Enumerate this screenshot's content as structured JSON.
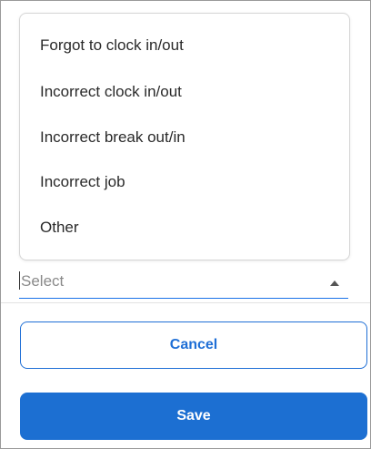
{
  "dropdown": {
    "options": [
      {
        "label": "Forgot to clock in/out"
      },
      {
        "label": "Incorrect clock in/out"
      },
      {
        "label": "Incorrect break out/in"
      },
      {
        "label": "Incorrect job"
      },
      {
        "label": "Other"
      }
    ],
    "arrow_icon": "caret-up-icon"
  },
  "select": {
    "placeholder": "Select"
  },
  "actions": {
    "cancel_label": "Cancel",
    "save_label": "Save"
  },
  "colors": {
    "accent": "#1c6fd2",
    "option_text": "#2a2a2a",
    "placeholder_text": "#8a8a8a"
  }
}
